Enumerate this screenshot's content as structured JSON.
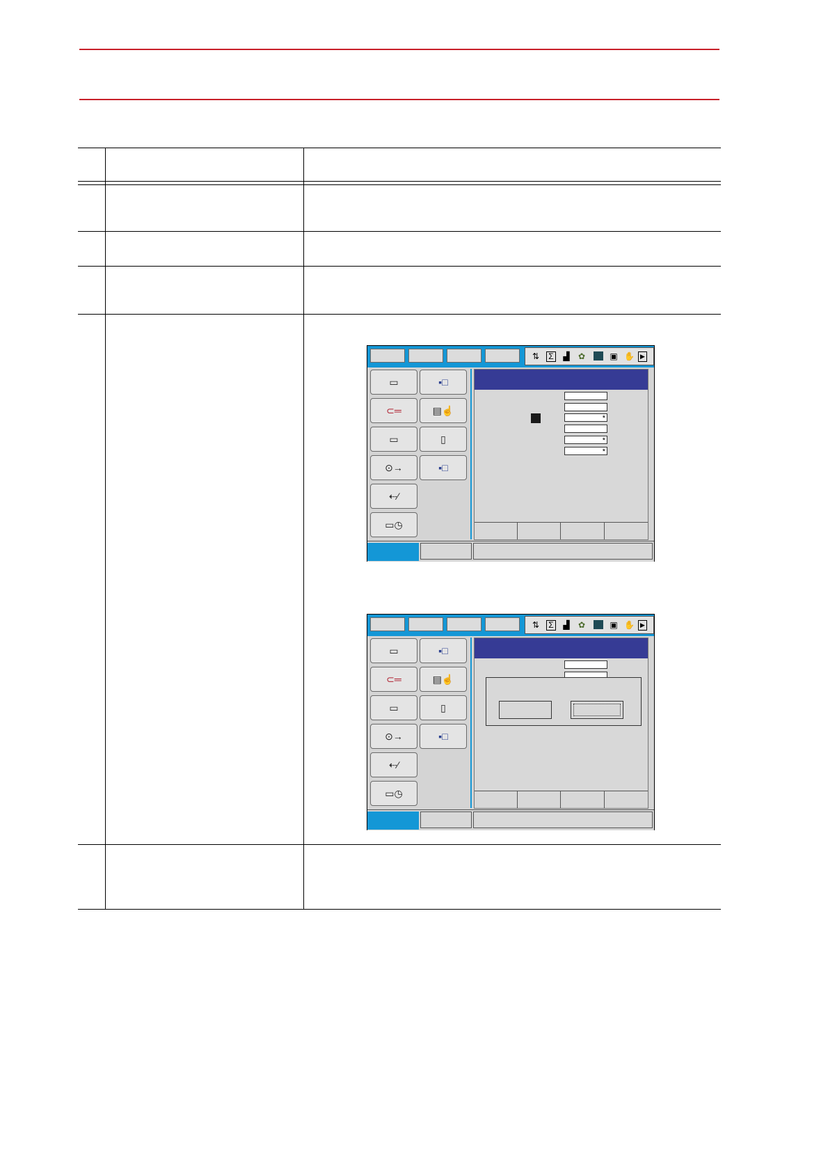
{
  "screen_a": {
    "fields": [
      "",
      "",
      "*",
      "",
      "*",
      "*"
    ]
  },
  "screen_b": {
    "fields": [
      "",
      "",
      "*",
      ""
    ]
  },
  "icons": {
    "status_icons": [
      "axis-icon",
      "job-icon",
      "signal-icon",
      "coordination-icon",
      "servo-icon",
      "io-icon",
      "hand-icon",
      "play-icon"
    ],
    "menu_icons": [
      "job-icon",
      "arc-welding-icon",
      "variable-icon",
      "in-out-icon",
      "robot-icon",
      "system-info-icon",
      "file-icon",
      "display-setup-icon",
      "setup-icon",
      "camera-icon"
    ]
  }
}
